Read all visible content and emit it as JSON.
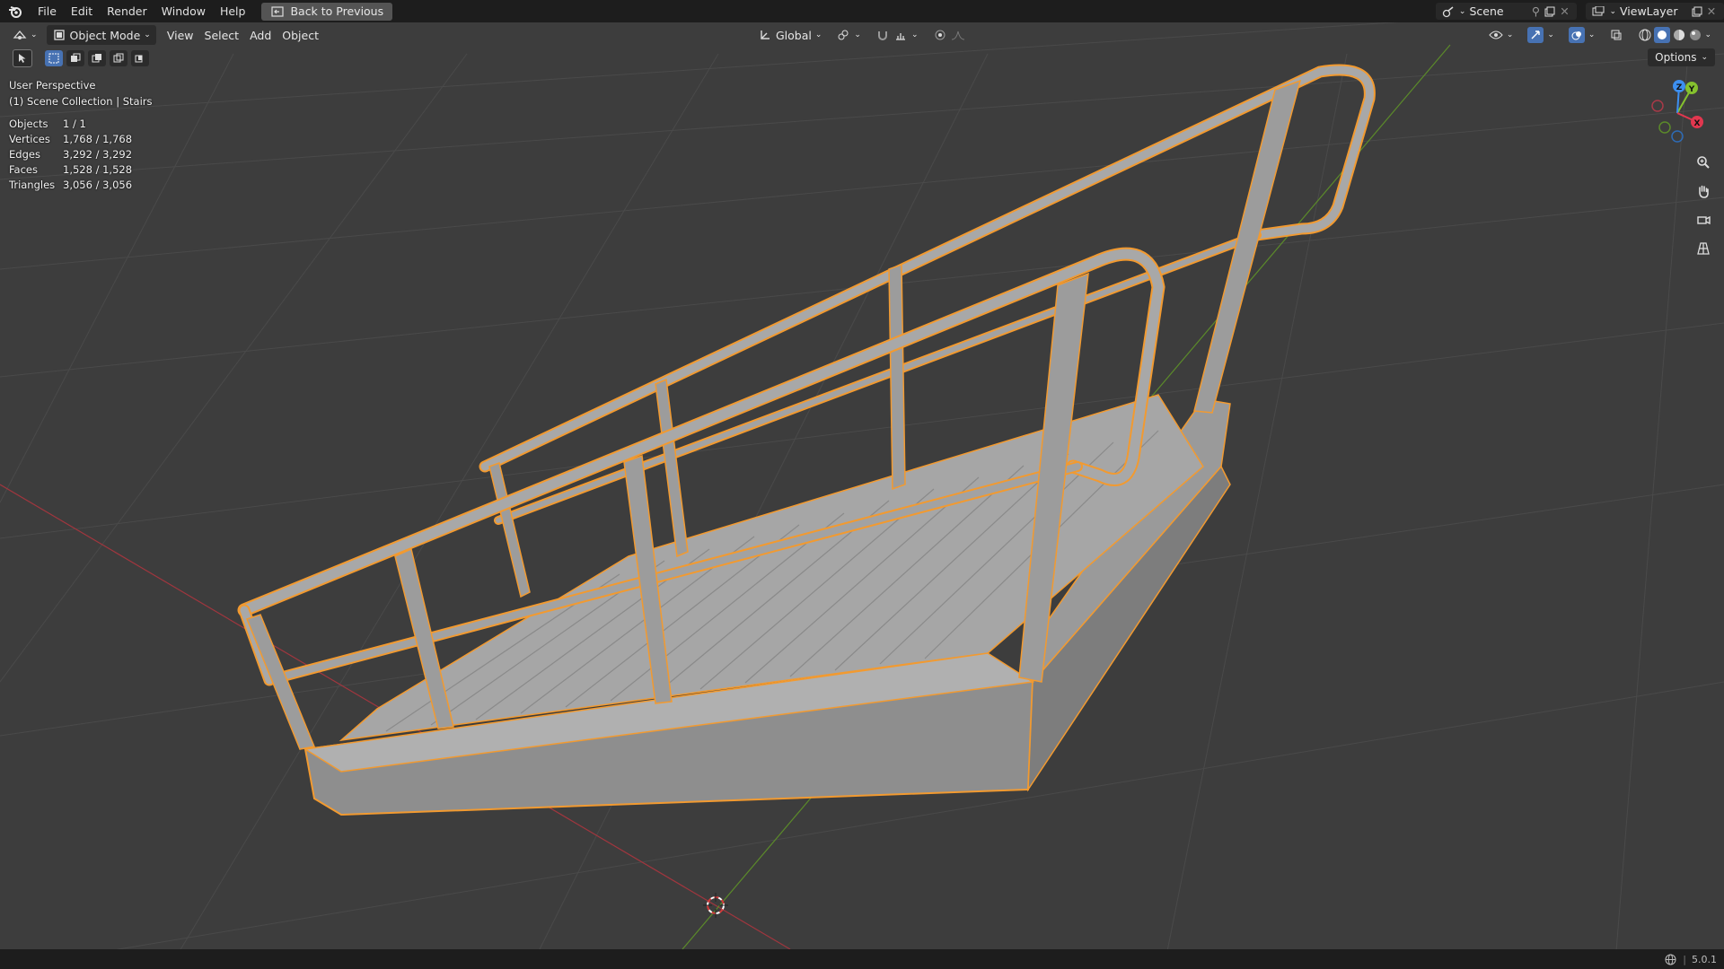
{
  "menu": {
    "items": [
      "File",
      "Edit",
      "Render",
      "Window",
      "Help"
    ],
    "back_label": "Back to Previous"
  },
  "workspace": {
    "scene_label": "Scene",
    "view_layer_label": "ViewLayer"
  },
  "viewport_header": {
    "mode_label": "Object Mode",
    "view_label": "View",
    "select_label": "Select",
    "add_label": "Add",
    "object_label": "Object",
    "orientation_label": "Global",
    "options_label": "Options"
  },
  "viewport_overlay": {
    "perspective_label": "User Perspective",
    "collection_label": "(1) Scene Collection | Stairs",
    "stats": [
      {
        "label": "Objects",
        "value": "1 / 1"
      },
      {
        "label": "Vertices",
        "value": "1,768 / 1,768"
      },
      {
        "label": "Edges",
        "value": "3,292 / 3,292"
      },
      {
        "label": "Faces",
        "value": "1,528 / 1,528"
      },
      {
        "label": "Triangles",
        "value": "3,056 / 3,056"
      }
    ]
  },
  "gizmo": {
    "x_label": "X",
    "y_label": "Y",
    "z_label": "Z",
    "x_color": "#e2374f",
    "y_color": "#85c12e",
    "z_color": "#3d8ff0"
  },
  "statusbar": {
    "version": "5.0.1"
  },
  "colors": {
    "accent_selection": "#f29a30",
    "header_bg": "#1d1d1d",
    "viewport_bg": "#3d3d3d",
    "active_button": "#4772b3"
  }
}
